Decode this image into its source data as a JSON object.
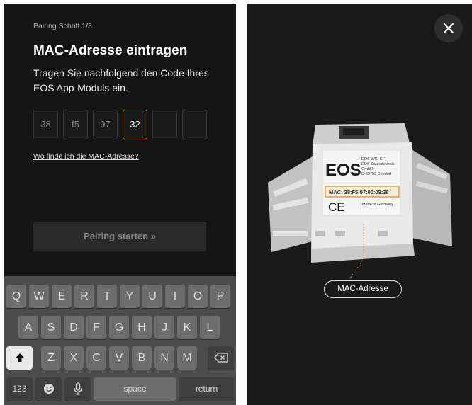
{
  "pairing": {
    "step": "Pairing Schritt 1/3",
    "title": "MAC-Adresse eintragen",
    "description": "Tragen Sie nachfolgend den Code Ihres EOS App-Moduls ein.",
    "mac_fields": [
      "38",
      "f5",
      "97",
      "32",
      "",
      ""
    ],
    "active_field": 3,
    "help_link": "Wo finde ich die MAC-Adresse?",
    "pair_button": "Pairing starten »"
  },
  "keyboard": {
    "row1": [
      "Q",
      "W",
      "E",
      "R",
      "T",
      "Y",
      "U",
      "I",
      "O",
      "P"
    ],
    "row2": [
      "A",
      "S",
      "D",
      "F",
      "G",
      "H",
      "J",
      "K",
      "L"
    ],
    "row3": [
      "Z",
      "X",
      "C",
      "V",
      "B",
      "N",
      "M"
    ],
    "numbers": "123",
    "space": "space",
    "return": "return"
  },
  "device": {
    "brand": "EOS",
    "model": "EOS-WCI-EF",
    "maker_lines": [
      "EOS Saunatechnik",
      "GmbH",
      "D-35759 Driedorf"
    ],
    "mac_label": "MAC: 38:F5:97:00:08:38",
    "made_in": "Made in Germany",
    "ce_mark": "CE",
    "callout": "MAC-Adresse",
    "highlight_color": "#e7a23b"
  },
  "icons": {
    "close": "close-icon",
    "shift": "shift-icon",
    "backspace": "backspace-icon",
    "emoji": "emoji-icon",
    "microphone": "microphone-icon"
  }
}
